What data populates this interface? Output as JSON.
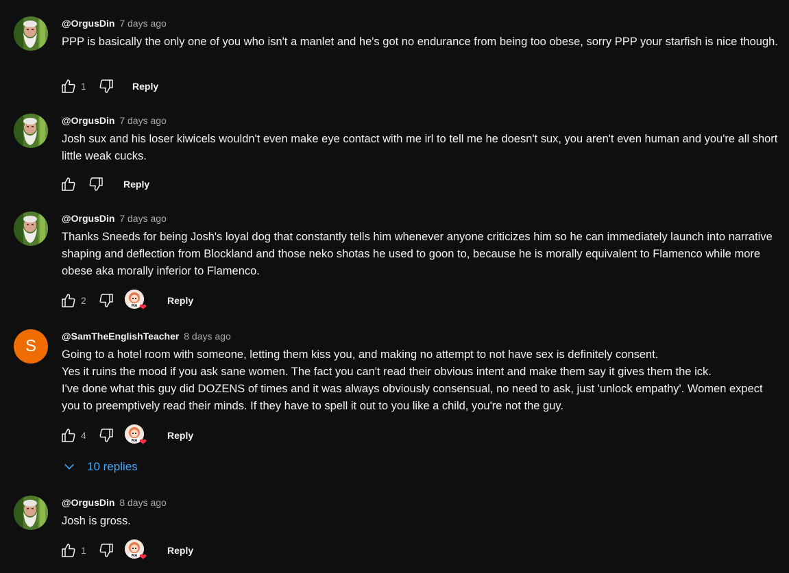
{
  "colors": {
    "background": "#0f0f0f",
    "text": "#f1f1f1",
    "muted": "#aaaaaa",
    "link": "#3ea6ff",
    "avatar_letter_bg": "#ef6c00",
    "heart": "#ff2a4a"
  },
  "icons": {
    "like": "thumbs-up-icon",
    "dislike": "thumbs-down-icon",
    "heart": "creator-heart-icon",
    "chevron": "chevron-down-icon"
  },
  "comments": [
    {
      "author": "@OrgusDin",
      "time": "7 days ago",
      "text": "PPP is basically the only one of you who isn't a manlet and he's got no endurance from being too obese, sorry PPP your starfish is nice though.",
      "likes": "1",
      "reply_label": "Reply"
    },
    {
      "author": "@OrgusDin",
      "time": "7 days ago",
      "text": "Josh sux and his loser kiwicels wouldn't even make eye contact with me irl to tell me he doesn't sux, you aren't even human and you're all short little weak cucks.",
      "likes": "",
      "reply_label": "Reply"
    },
    {
      "author": "@OrgusDin",
      "time": "7 days ago",
      "text": "Thanks Sneeds for being Josh's loyal dog that constantly tells him whenever anyone criticizes him so he can immediately launch into narrative shaping and deflection from Blockland and those neko shotas he used to goon to, because he is morally equivalent to Flamenco while more obese aka morally inferior to Flamenco.",
      "likes": "2",
      "reply_label": "Reply"
    },
    {
      "author": "@SamTheEnglishTeacher",
      "time": "8 days ago",
      "avatar_letter": "S",
      "text_lines": [
        "Going to a hotel room with someone, letting them kiss you, and making no attempt to not have sex is definitely consent.",
        "Yes it ruins the mood if you ask sane women. The fact you can't read their obvious intent and make them say it gives them the ick.",
        "I've done what this guy did DOZENS of times and it was always obviously consensual, no need to ask, just 'unlock empathy'. Women expect you to preemptively read their minds. If they have to spell it out to you like a child, you're not the guy."
      ],
      "likes": "4",
      "reply_label": "Reply",
      "replies_toggle": "10 replies"
    },
    {
      "author": "@OrgusDin",
      "time": "8 days ago",
      "text": "Josh is gross.",
      "likes": "1",
      "reply_label": "Reply"
    }
  ]
}
